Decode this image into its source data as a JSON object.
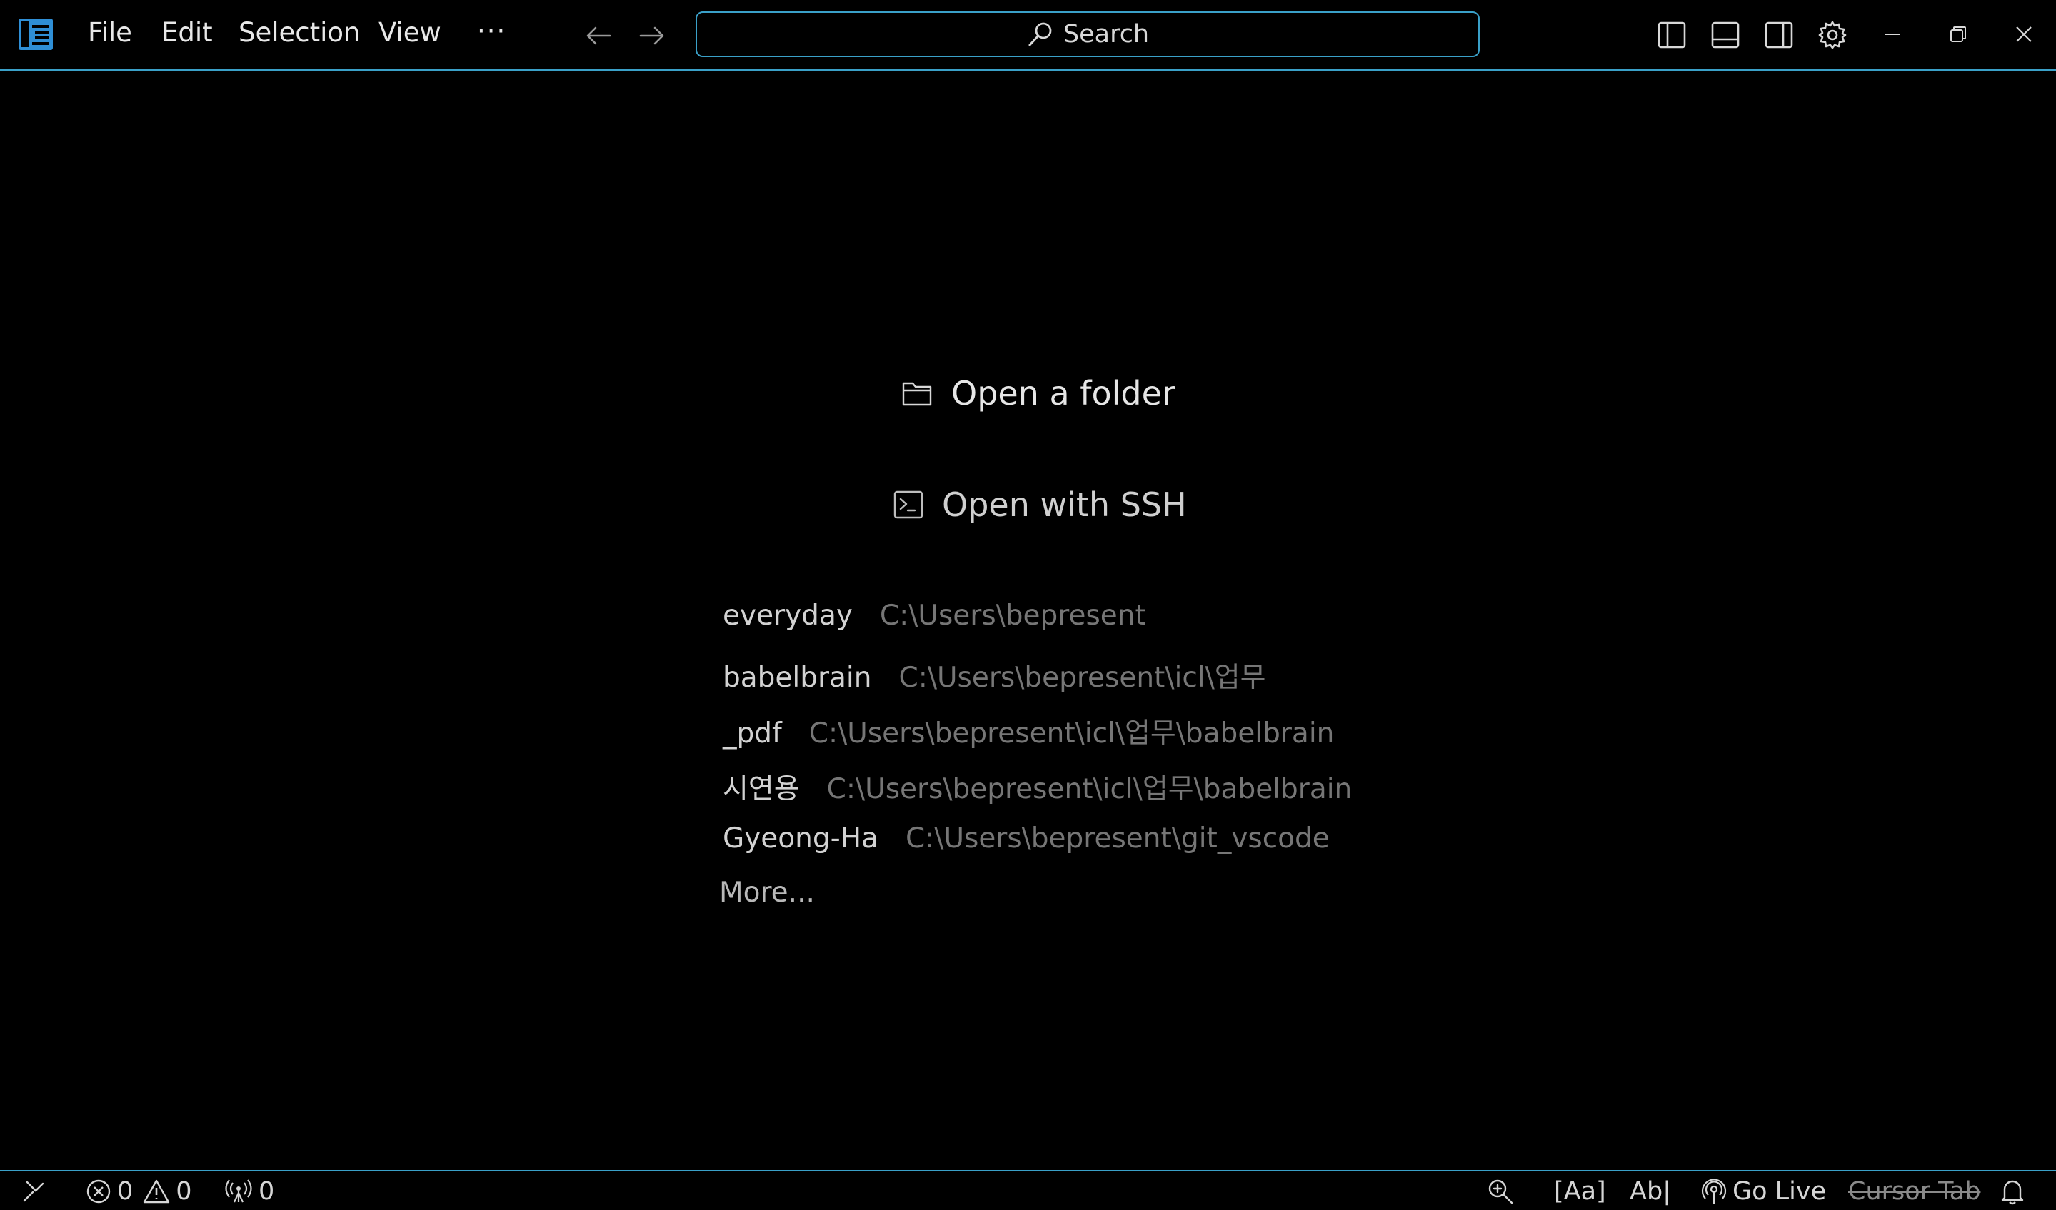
{
  "menu": {
    "file": "File",
    "edit": "Edit",
    "selection": "Selection",
    "view": "View",
    "more": "···"
  },
  "search": {
    "label": "Search"
  },
  "welcome": {
    "open_folder": "Open a folder",
    "open_ssh": "Open with SSH",
    "recent": [
      {
        "name": "everyday",
        "path": "C:\\Users\\bepresent"
      },
      {
        "name": "babelbrain",
        "path": "C:\\Users\\bepresent\\icl\\업무"
      },
      {
        "name": "_pdf",
        "path": "C:\\Users\\bepresent\\icl\\업무\\babelbrain"
      },
      {
        "name": "시연용",
        "path": "C:\\Users\\bepresent\\icl\\업무\\babelbrain"
      },
      {
        "name": "Gyeong-Ha",
        "path": "C:\\Users\\bepresent\\git_vscode"
      }
    ],
    "more": "More..."
  },
  "statusbar": {
    "errors": "0",
    "warnings": "0",
    "ports": "0",
    "case_toggle": "[Aa]",
    "word_toggle": "Ab|",
    "go_live": "Go Live",
    "cursor_tab": "Cursor Tab"
  },
  "colors": {
    "accent": "#3aa0c8",
    "logo": "#2f8fd6",
    "background": "#000000"
  }
}
